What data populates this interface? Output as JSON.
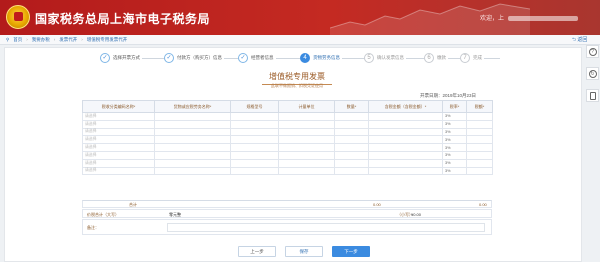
{
  "header": {
    "site_title": "国家税务总局上海市电子税务局",
    "user_greeting": "欢迎，上"
  },
  "breadcrumb": {
    "items": [
      "首页",
      "我要办税",
      "发票代开",
      "增值税专用发票代开"
    ]
  },
  "back_label": "返回",
  "steps": [
    {
      "num": "✓",
      "label": "选择开票方式",
      "state": "done"
    },
    {
      "num": "✓",
      "label": "付款方（购买方）信息",
      "state": "done"
    },
    {
      "num": "✓",
      "label": "经营者信息",
      "state": "done"
    },
    {
      "num": "4",
      "label": "货物劳务信息",
      "state": "active"
    },
    {
      "num": "5",
      "label": "确认发票信息",
      "state": "pending"
    },
    {
      "num": "6",
      "label": "缴款",
      "state": "pending"
    },
    {
      "num": "7",
      "label": "完成",
      "state": "pending"
    }
  ],
  "invoice": {
    "title": "增值税专用发票",
    "subtitle": "此联不做报销、扣税凭证使用",
    "date": "开票日期：2019年10月23日"
  },
  "table": {
    "headers": [
      "税收分类编码名称*",
      "货物或应税劳务名称*",
      "规格型号",
      "计量单位",
      "数量*",
      "含税金额（含税金额）*",
      "税率*",
      "税额*"
    ],
    "placeholder": "请选择",
    "rate": "3%",
    "rows": 8
  },
  "totals": {
    "label": "合计",
    "amount": "0.00",
    "tax": "0.00"
  },
  "sum": {
    "label": "价税合计（大写）",
    "upper": "零元整",
    "lower_label": "（小写）",
    "lower": "¥0.00"
  },
  "note": {
    "label": "备注："
  },
  "buttons": {
    "prev": "上一步",
    "save": "保存",
    "next": "下一步"
  },
  "colors": {
    "header_red": "#b31b1b",
    "accent_blue": "#3b8be0"
  },
  "icons": [
    "emblem-icon",
    "home-icon",
    "help-icon",
    "refresh-icon",
    "document-icon"
  ]
}
